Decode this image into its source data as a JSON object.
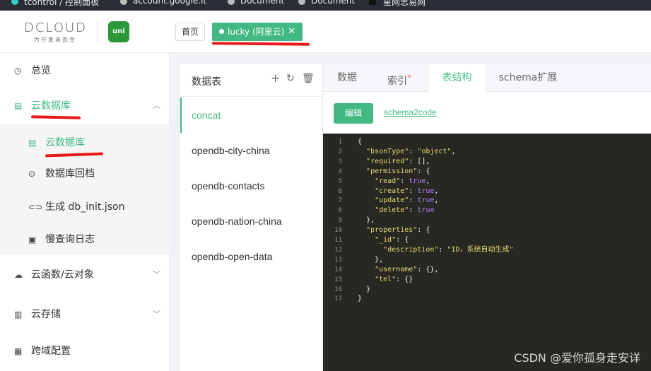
{
  "bookmarks": [
    "tcontrol / 控制面板",
    "account.google.it",
    "Document",
    "Document",
    "星网思易网"
  ],
  "header": {
    "logo_text": "DCLOUD",
    "logo_slogan": "为开发者而生",
    "uni_logo": "uni",
    "tabs": [
      {
        "label": "首页"
      },
      {
        "label": "lucky (阿里云)",
        "close": "✕"
      }
    ]
  },
  "sidebar": {
    "items": [
      {
        "label": "总览",
        "icon": "clock-icon"
      },
      {
        "label": "云数据库",
        "icon": "database-icon"
      },
      {
        "label": "云函数/云对象",
        "icon": "cloud-icon"
      },
      {
        "label": "云存储",
        "icon": "storage-icon"
      },
      {
        "label": "跨域配置",
        "icon": "settings-icon"
      }
    ],
    "subitems": [
      {
        "label": "云数据库"
      },
      {
        "label": "数据库回档"
      },
      {
        "label": "生成 db_init.json"
      },
      {
        "label": "慢查询日志"
      }
    ]
  },
  "tables_panel": {
    "title": "数据表",
    "tables": [
      "concat",
      "opendb-city-china",
      "opendb-contacts",
      "opendb-nation-china",
      "opendb-open-data"
    ],
    "selected": "concat"
  },
  "tabs": [
    {
      "label": "数据",
      "marker": ""
    },
    {
      "label": "索引",
      "marker": "*"
    },
    {
      "label": "表结构",
      "marker": ""
    },
    {
      "label": "schema扩展",
      "marker": ""
    }
  ],
  "buttons": {
    "edit": "编辑",
    "schema2code": "schema2code"
  },
  "code_lines": [
    {
      "n": "1",
      "t": "{"
    },
    {
      "n": "2",
      "t": "  \"bsonType\": \"object\","
    },
    {
      "n": "3",
      "t": "  \"required\": [],"
    },
    {
      "n": "4",
      "t": "  \"permission\": {"
    },
    {
      "n": "5",
      "t": "    \"read\": true,"
    },
    {
      "n": "6",
      "t": "    \"create\": true,"
    },
    {
      "n": "7",
      "t": "    \"update\": true,"
    },
    {
      "n": "8",
      "t": "    \"delete\": true"
    },
    {
      "n": "9",
      "t": "  },"
    },
    {
      "n": "10",
      "t": "  \"properties\": {"
    },
    {
      "n": "11",
      "t": "    \"_id\": {"
    },
    {
      "n": "12",
      "t": "      \"description\": \"ID，系统自动生成\""
    },
    {
      "n": "13",
      "t": "    },"
    },
    {
      "n": "14",
      "t": "    \"username\": {},"
    },
    {
      "n": "15",
      "t": "    \"tel\": {}"
    },
    {
      "n": "16",
      "t": "  }"
    },
    {
      "n": "17",
      "t": "}"
    }
  ],
  "watermark": "CSDN @爱你孤身走安详",
  "colors": {
    "accent": "#42b983",
    "editor_bg": "#272822",
    "annotation": "#e81919"
  }
}
